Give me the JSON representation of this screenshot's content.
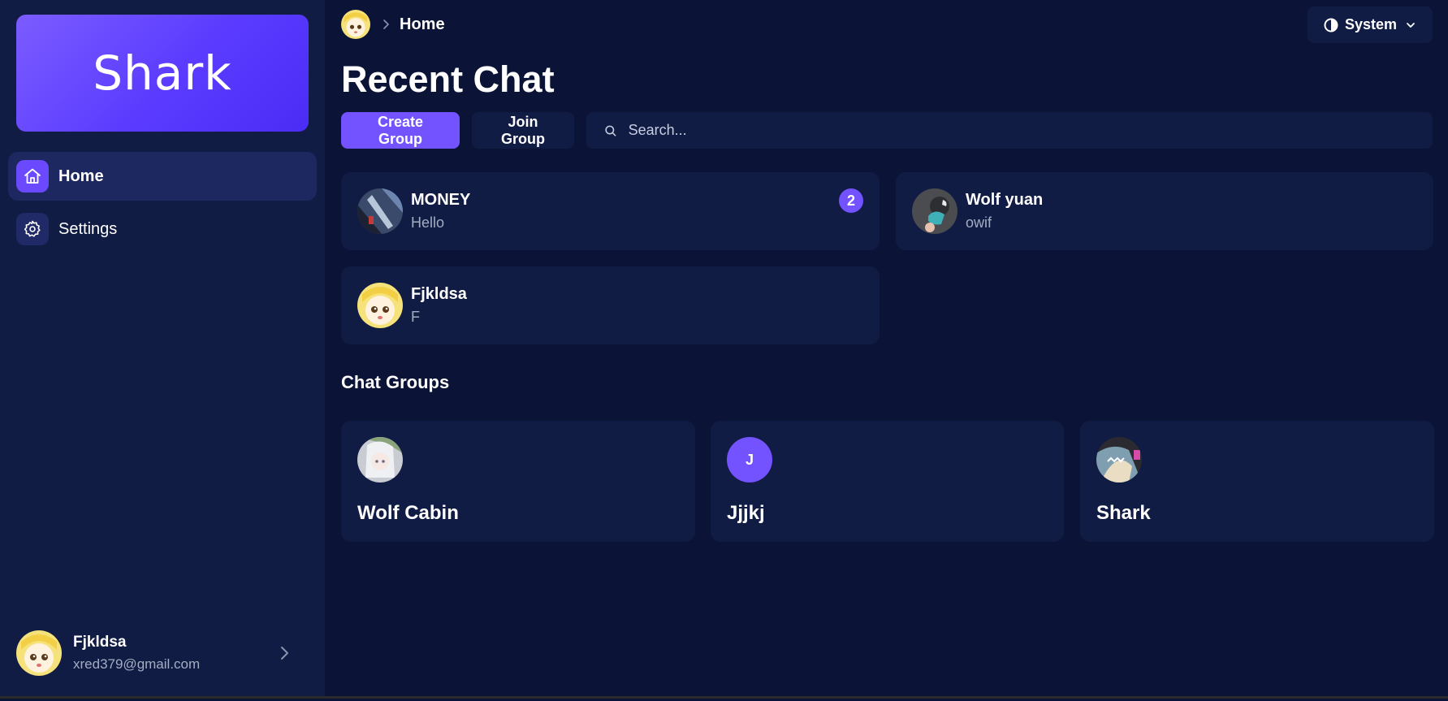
{
  "sidebar": {
    "brand": "Shark",
    "nav": [
      {
        "label": "Home",
        "icon": "home-icon",
        "active": true
      },
      {
        "label": "Settings",
        "icon": "gear-icon",
        "active": false
      }
    ],
    "user": {
      "name": "Fjkldsa",
      "email": "xred379@gmail.com"
    }
  },
  "topbar": {
    "breadcrumb": "Home",
    "theme_label": "System"
  },
  "main": {
    "title": "Recent Chat",
    "create_group_label": "Create Group",
    "join_group_label": "Join Group",
    "search_placeholder": "Search...",
    "chats": [
      {
        "name": "MONEY",
        "message": "Hello",
        "unread": "2"
      },
      {
        "name": "Wolf yuan",
        "message": "owif"
      },
      {
        "name": "Fjkldsa",
        "message": "F"
      }
    ],
    "groups_title": "Chat Groups",
    "groups": [
      {
        "name": "Wolf Cabin"
      },
      {
        "name": "Jjjkj",
        "initial": "J"
      },
      {
        "name": "Shark"
      }
    ]
  },
  "colors": {
    "background": "#0b1437",
    "panel": "#111c44",
    "accent": "#7352ff",
    "muted_text": "#a3adc2"
  }
}
